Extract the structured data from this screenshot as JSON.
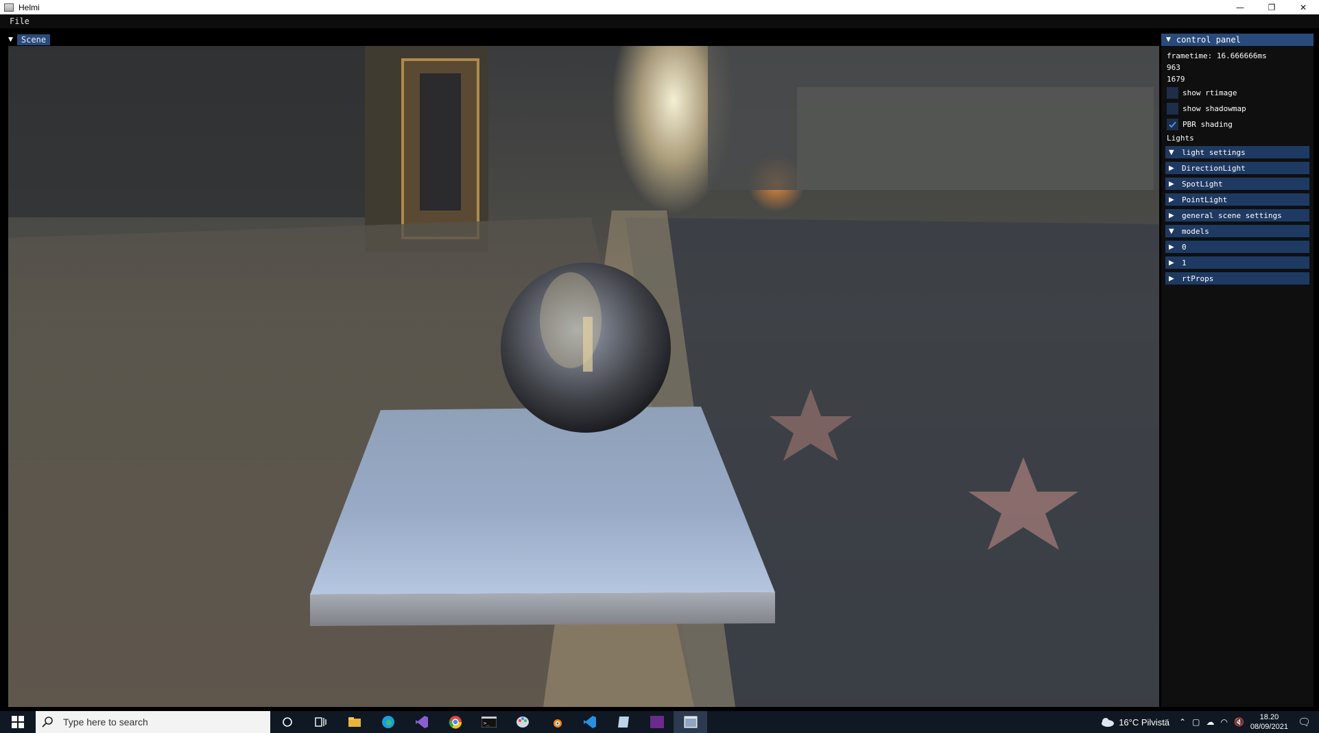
{
  "window": {
    "title": "Helmi",
    "minimize": "—",
    "restore": "❐",
    "close": "✕"
  },
  "menu": {
    "file": "File"
  },
  "scene": {
    "tab_label": "Scene",
    "collapse_icon": "triangle-down-icon"
  },
  "control_panel": {
    "title": "control panel",
    "frametime": "frametime: 16.666666ms",
    "width_value": "963",
    "height_value": "1679",
    "checkboxes": [
      {
        "label": "show rtimage",
        "checked": false
      },
      {
        "label": "show shadowmap",
        "checked": false
      },
      {
        "label": "PBR shading",
        "checked": true
      }
    ],
    "lights_label": "Lights",
    "tree": [
      {
        "label": "light settings",
        "expanded": true
      },
      {
        "label": "DirectionLight",
        "expanded": false
      },
      {
        "label": "SpotLight",
        "expanded": false
      },
      {
        "label": "PointLight",
        "expanded": false
      },
      {
        "label": "general scene settings",
        "expanded": false
      },
      {
        "label": "models",
        "expanded": true
      },
      {
        "label": "0",
        "expanded": false
      },
      {
        "label": "1",
        "expanded": false
      },
      {
        "label": "rtProps",
        "expanded": false
      }
    ]
  },
  "taskbar": {
    "search_placeholder": "Type here to search",
    "weather": "16°C  Pilvistä",
    "time": "18.20",
    "date": "08/09/2021"
  },
  "colors": {
    "panel_header": "#294a7a",
    "tree_row": "#1e3a63",
    "checkbox": "#1d2e49",
    "taskbar": "#101824"
  }
}
